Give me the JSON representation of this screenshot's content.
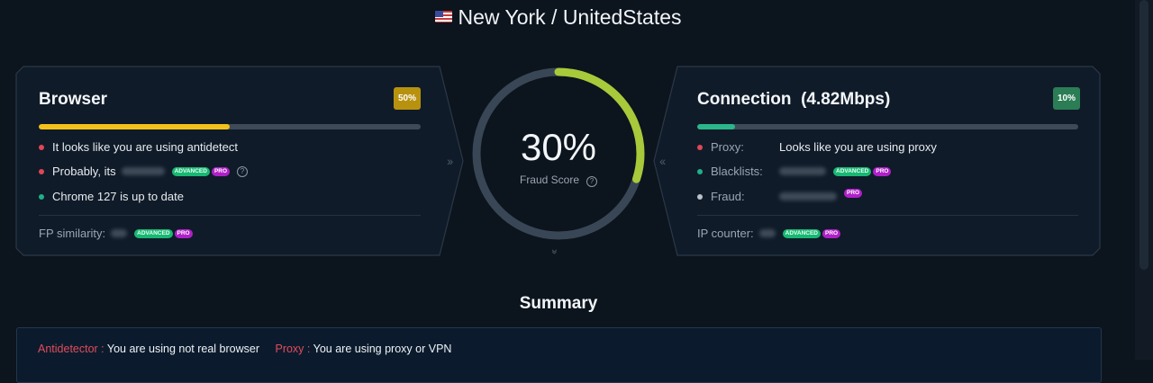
{
  "location": {
    "text": "New York / UnitedStates",
    "flag_icon": "us-flag-icon"
  },
  "browser": {
    "title": "Browser",
    "badge": "50%",
    "progress": 0.5,
    "items": [
      {
        "text": "It looks like you are using antidetect",
        "dot": "red"
      },
      {
        "text": "Probably, its",
        "dot": "red",
        "tags": [
          "ADVANCED",
          "PRO"
        ]
      },
      {
        "text": "Chrome 127 is up to date",
        "dot": "teal"
      }
    ],
    "fp_label": "FP similarity:",
    "tags": [
      "ADVANCED",
      "PRO"
    ]
  },
  "score": {
    "value": "30%",
    "label": "Fraud Score",
    "fraction": 0.3
  },
  "connection": {
    "title": "Connection",
    "speed": "(4.82Mbps)",
    "badge": "10%",
    "progress": 0.1,
    "rows": [
      {
        "label": "Proxy:",
        "value": "Looks like you are using proxy",
        "dot": "red"
      },
      {
        "label": "Blacklists:",
        "dot": "teal",
        "tags": [
          "ADVANCED",
          "PRO"
        ]
      },
      {
        "label": "Fraud:",
        "dot": "grey",
        "tags": [
          "PRO"
        ]
      }
    ],
    "ip_label": "IP counter:",
    "tags": [
      "ADVANCED",
      "PRO"
    ]
  },
  "summary": {
    "title": "Summary",
    "items": [
      {
        "key": "Antidetector :",
        "value": "You are using not real browser"
      },
      {
        "key": "Proxy :",
        "value": "You are using proxy or VPN"
      }
    ]
  },
  "colors": {
    "yellow": "#f2c21b",
    "teal": "#2bb58a",
    "gauge": "#a7c93a",
    "track": "#394656",
    "panel_bg": "#101b29",
    "border": "#2a3848"
  }
}
